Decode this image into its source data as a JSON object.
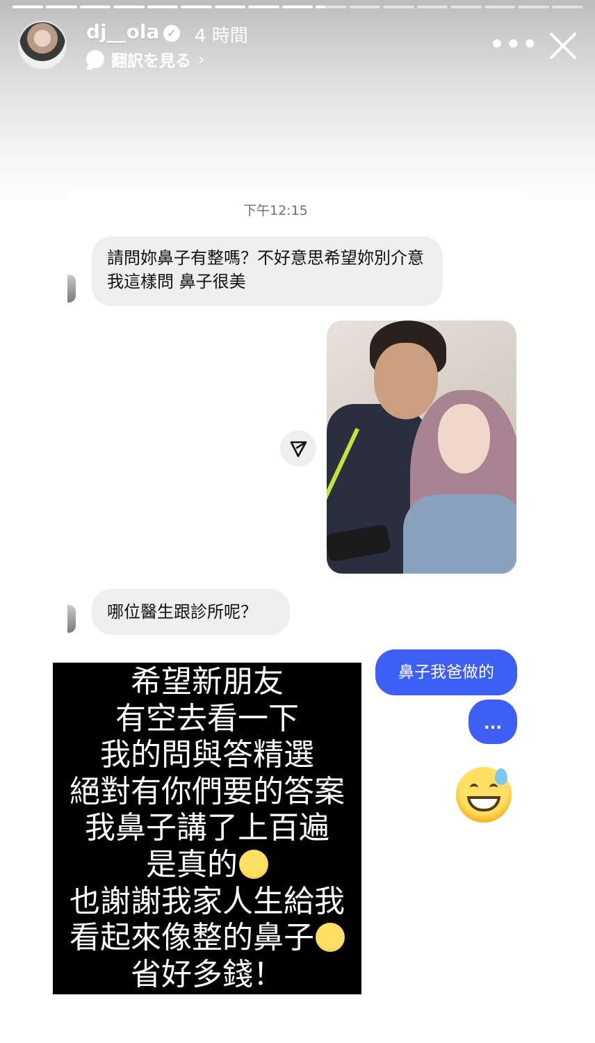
{
  "story": {
    "segments": [
      "done",
      "done",
      "done",
      "done",
      "done",
      "done",
      "done",
      "done",
      "done",
      "partial",
      "empty",
      "empty",
      "empty",
      "empty",
      "empty",
      "empty",
      "empty"
    ],
    "username": "dj__ola",
    "time": "4 時間",
    "translate_label": "翻訳を見る",
    "more_label": "•••"
  },
  "chat": {
    "timestamp": "下午12:15",
    "messages": {
      "q1": "請問妳鼻子有整嗎？不好意思希望妳別介意我這樣問 鼻子很美",
      "q2": "哪位醫生跟診所呢？",
      "a1": "鼻子我爸做的",
      "a2": "..."
    }
  },
  "caption": {
    "lines": [
      "希望新朋友",
      "有空去看一下",
      "我的問與答精選",
      "絕對有你們要的答案",
      "我鼻子講了上百遍",
      "是真的",
      "也謝謝我家人生給我",
      "看起來像整的鼻子",
      "省好多錢！"
    ]
  },
  "colors": {
    "outgoing_bubble": "#3d5ff6",
    "incoming_bubble": "#efefef",
    "overlay": "#000000"
  }
}
